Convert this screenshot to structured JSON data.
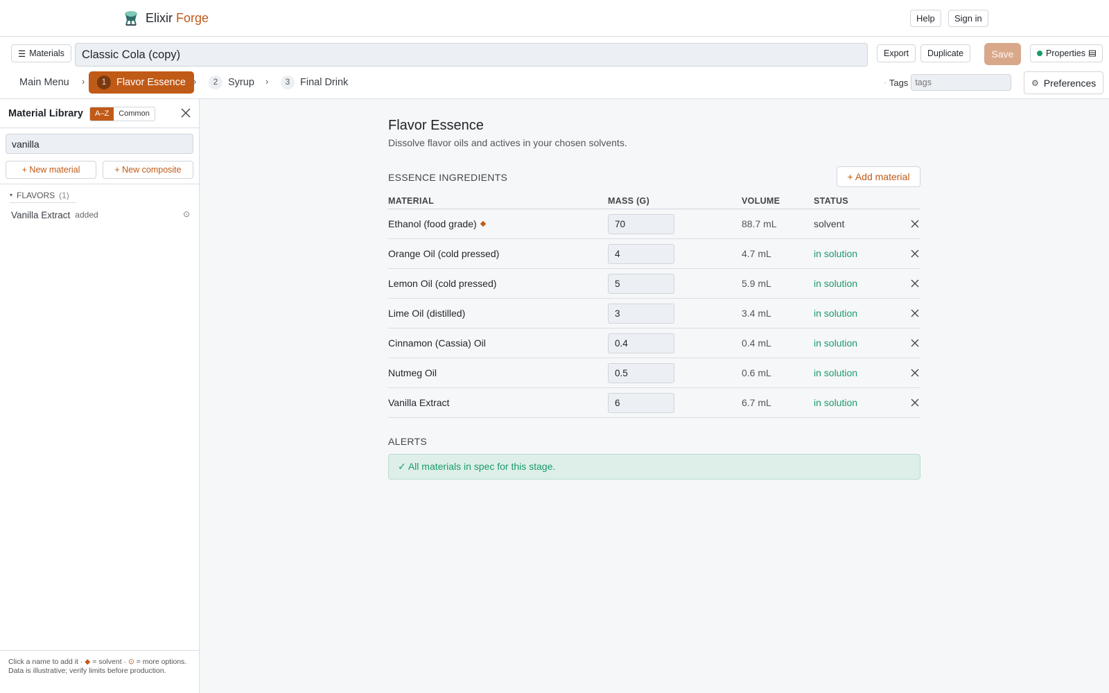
{
  "header": {
    "brand_first": "Elixir",
    "brand_second": "Forge",
    "help_label": "Help",
    "signin_label": "Sign in"
  },
  "docbar": {
    "materials_label": "Materials",
    "title_value": "Classic Cola (copy)",
    "export_label": "Export",
    "duplicate_label": "Duplicate",
    "save_label": "Save",
    "properties_label": "Properties",
    "main_menu_label": "Main Menu",
    "steps": [
      {
        "num": "1",
        "label": "Flavor Essence",
        "active": true
      },
      {
        "num": "2",
        "label": "Syrup",
        "active": false
      },
      {
        "num": "3",
        "label": "Final Drink",
        "active": false
      }
    ],
    "tags_label": "Tags",
    "tags_placeholder": "tags",
    "preferences_label": "Preferences"
  },
  "sidebar": {
    "title": "Material Library",
    "sort_az": "A–Z",
    "sort_common": "Common",
    "search_value": "vanilla",
    "new_material_label": "+ New material",
    "new_composite_label": "+ New composite",
    "group_label": "FLAVORS",
    "group_count": "(1)",
    "items": [
      {
        "name": "Vanilla Extract",
        "tag": "added"
      }
    ],
    "footnote_1": "Click a name to add it · ",
    "footnote_2": " = solvent · ",
    "footnote_3": " = more options. Data is illustrative; verify limits before production."
  },
  "main": {
    "title": "Flavor Essence",
    "subtitle": "Dissolve flavor oils and actives in your chosen solvents.",
    "section_label": "ESSENCE INGREDIENTS",
    "add_material_label": "+ Add material",
    "columns": [
      "MATERIAL",
      "MASS (G)",
      "VOLUME",
      "STATUS"
    ],
    "rows": [
      {
        "material": "Ethanol (food grade)",
        "mass": "70",
        "volume": "88.7 mL",
        "status": "solvent",
        "solvent": true
      },
      {
        "material": "Orange Oil (cold pressed)",
        "mass": "4",
        "volume": "4.7 mL",
        "status": "in solution",
        "solvent": false
      },
      {
        "material": "Lemon Oil (cold pressed)",
        "mass": "5",
        "volume": "5.9 mL",
        "status": "in solution",
        "solvent": false
      },
      {
        "material": "Lime Oil (distilled)",
        "mass": "3",
        "volume": "3.4 mL",
        "status": "in solution",
        "solvent": false
      },
      {
        "material": "Cinnamon (Cassia) Oil",
        "mass": "0.4",
        "volume": "0.4 mL",
        "status": "in solution",
        "solvent": false
      },
      {
        "material": "Nutmeg Oil",
        "mass": "0.5",
        "volume": "0.6 mL",
        "status": "in solution",
        "solvent": false
      },
      {
        "material": "Vanilla Extract",
        "mass": "6",
        "volume": "6.7 mL",
        "status": "in solution",
        "solvent": false
      }
    ],
    "alerts_label": "ALERTS",
    "alert_message": "✓ All materials in spec for this stage."
  },
  "colors": {
    "accent": "#c05a17",
    "success": "#1a9a6a",
    "save_disabled": "#d9a88a"
  }
}
